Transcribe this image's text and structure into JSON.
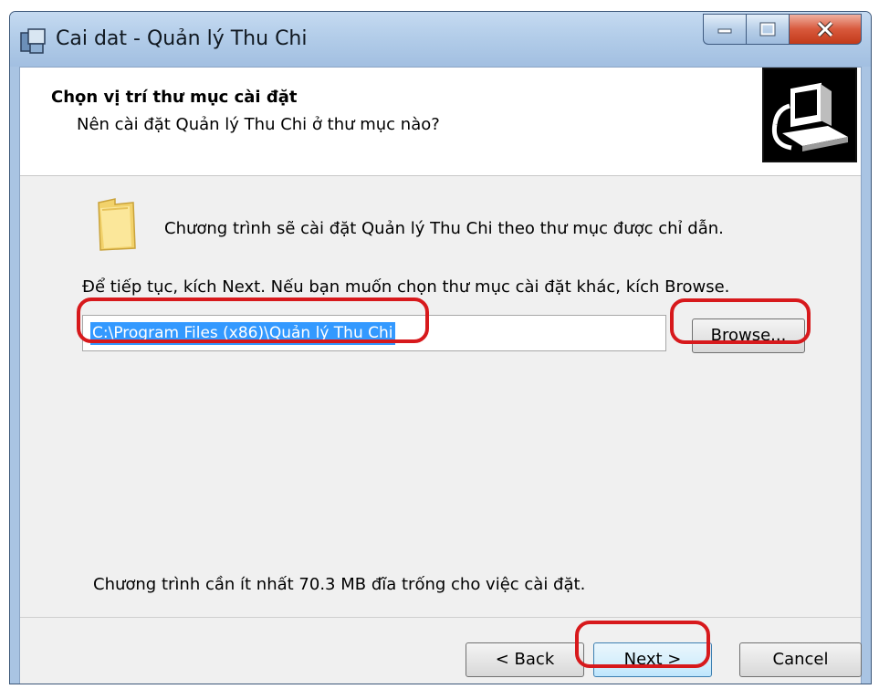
{
  "window": {
    "title": "Cai dat - Quản lý Thu Chi",
    "controls": [
      "minimize-icon",
      "maximize-icon",
      "close-icon"
    ]
  },
  "header": {
    "title": "Chọn vị trí thư mục cài đặt",
    "subtitle": "Nên cài đặt Quản lý Thu Chi ở thư mục nào?"
  },
  "body": {
    "intro": "Chương trình sẽ cài đặt Quản lý Thu Chi theo thư mục được chỉ dẫn.",
    "instruction": "Để tiếp tục, kích Next. Nếu bạn muốn chọn thư mục cài đặt khác, kích Browse.",
    "path_value": "C:\\Program Files (x86)\\Quản lý Thu Chi",
    "browse_label": "Browse...",
    "space_required": "Chương trình cần ít nhất 70.3 MB đĩa trống cho việc cài đặt."
  },
  "footer": {
    "back_label": "< Back",
    "next_label": "Next >",
    "cancel_label": "Cancel"
  },
  "colors": {
    "selection": "#3399ff",
    "highlight_ring": "#d7191c",
    "titlebar": "#b3cde9"
  }
}
